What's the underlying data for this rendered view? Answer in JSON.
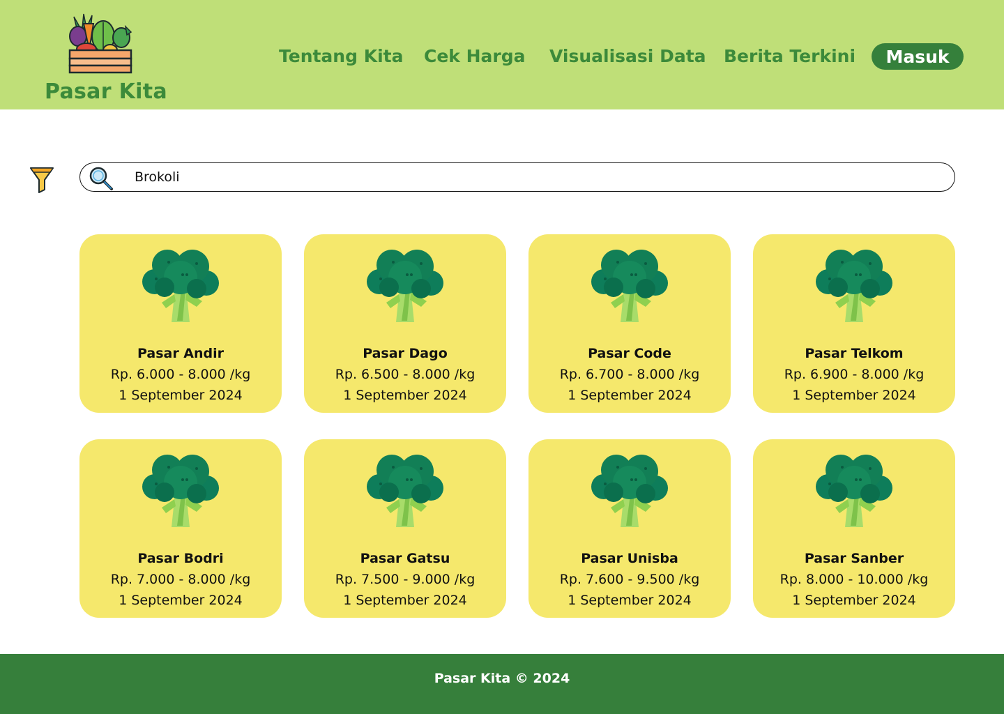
{
  "header": {
    "brand": "Pasar Kita",
    "logo_icon": "vegetable-crate-icon",
    "nav": [
      {
        "label": "Tentang Kita"
      },
      {
        "label": "Cek Harga"
      },
      {
        "label": "Visualisasi Data"
      },
      {
        "label": "Berita Terkini"
      }
    ],
    "login_label": "Masuk"
  },
  "search": {
    "filter_icon": "filter-funnel-icon",
    "search_icon": "magnifier-icon",
    "value": "Brokoli"
  },
  "cards": [
    {
      "name": "Pasar Andir",
      "price": "Rp. 6.000 - 8.000 /kg",
      "date": "1 September 2024",
      "icon": "broccoli-icon"
    },
    {
      "name": "Pasar Dago",
      "price": "Rp. 6.500 - 8.000 /kg",
      "date": "1 September 2024",
      "icon": "broccoli-icon"
    },
    {
      "name": "Pasar Code",
      "price": "Rp. 6.700 - 8.000 /kg",
      "date": "1 September 2024",
      "icon": "broccoli-icon"
    },
    {
      "name": "Pasar Telkom",
      "price": "Rp. 6.900 - 8.000 /kg",
      "date": "1 September 2024",
      "icon": "broccoli-icon"
    },
    {
      "name": "Pasar Bodri",
      "price": "Rp. 7.000 - 8.000 /kg",
      "date": "1 September 2024",
      "icon": "broccoli-icon"
    },
    {
      "name": "Pasar Gatsu",
      "price": "Rp. 7.500 - 9.000 /kg",
      "date": "1 September 2024",
      "icon": "broccoli-icon"
    },
    {
      "name": "Pasar Unisba",
      "price": "Rp. 7.600 - 9.500 /kg",
      "date": "1 September 2024",
      "icon": "broccoli-icon"
    },
    {
      "name": "Pasar Sanber",
      "price": "Rp. 8.000 - 10.000 /kg",
      "date": "1 September 2024",
      "icon": "broccoli-icon"
    }
  ],
  "footer": {
    "text": "Pasar Kita © 2024"
  },
  "colors": {
    "header_bg": "#bfdf78",
    "brand_green": "#3c8a3a",
    "button_green": "#35803b",
    "card_yellow": "#f5e86c",
    "footer_green": "#367f3b"
  }
}
